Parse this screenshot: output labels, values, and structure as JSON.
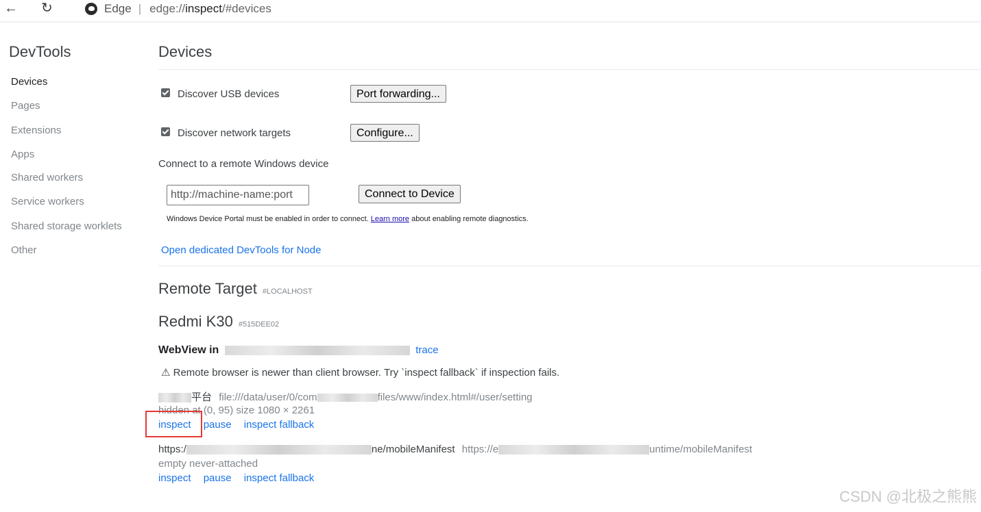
{
  "browser": {
    "app_name": "Edge",
    "url_scheme": "edge://",
    "url_host": "inspect",
    "url_fragment": "/#devices",
    "back_icon": "arrow-left-icon",
    "reload_icon": "reload-icon"
  },
  "sidebar": {
    "title": "DevTools",
    "items": [
      {
        "label": "Devices"
      },
      {
        "label": "Pages"
      },
      {
        "label": "Extensions"
      },
      {
        "label": "Apps"
      },
      {
        "label": "Shared workers"
      },
      {
        "label": "Service workers"
      },
      {
        "label": "Shared storage worklets"
      },
      {
        "label": "Other"
      }
    ]
  },
  "main": {
    "title": "Devices",
    "discover_usb_label": "Discover USB devices",
    "discover_usb_checked": true,
    "port_forwarding_button": "Port forwarding...",
    "discover_network_label": "Discover network targets",
    "discover_network_checked": true,
    "configure_button": "Configure...",
    "remote_windows_label": "Connect to a remote Windows device",
    "remote_input_placeholder": "http://machine-name:port",
    "connect_button": "Connect to Device",
    "note_before": "Windows Device Portal must be enabled in order to connect.",
    "note_link": "Learn more",
    "note_after": "about enabling remote diagnostics.",
    "node_link": "Open dedicated DevTools for Node"
  },
  "remote": {
    "title": "Remote Target",
    "tag": "#LOCALHOST",
    "device_name": "Redmi K30",
    "device_id": "#515DEE02",
    "browser_label": "WebView in",
    "trace_link": "trace",
    "warning": "⚠ Remote browser is newer than client browser. Try `inspect fallback` if inspection fails.",
    "targets": [
      {
        "title_suffix": "平台",
        "url_prefix": "file:///data/user/0/com",
        "url_suffix": "files/www/index.html#/user/setting",
        "status": "hidden  at (0, 95)  size 1080 × 2261",
        "actions": [
          "inspect",
          "pause",
          "inspect fallback"
        ]
      },
      {
        "title_prefix": "https:/",
        "title_suffix": "ne/mobileManifest",
        "url_prefix": "https://e",
        "url_suffix": "untime/mobileManifest",
        "status": "empty never-attached",
        "actions": [
          "inspect",
          "pause",
          "inspect fallback"
        ]
      }
    ]
  },
  "watermark": "CSDN @北极之熊熊"
}
